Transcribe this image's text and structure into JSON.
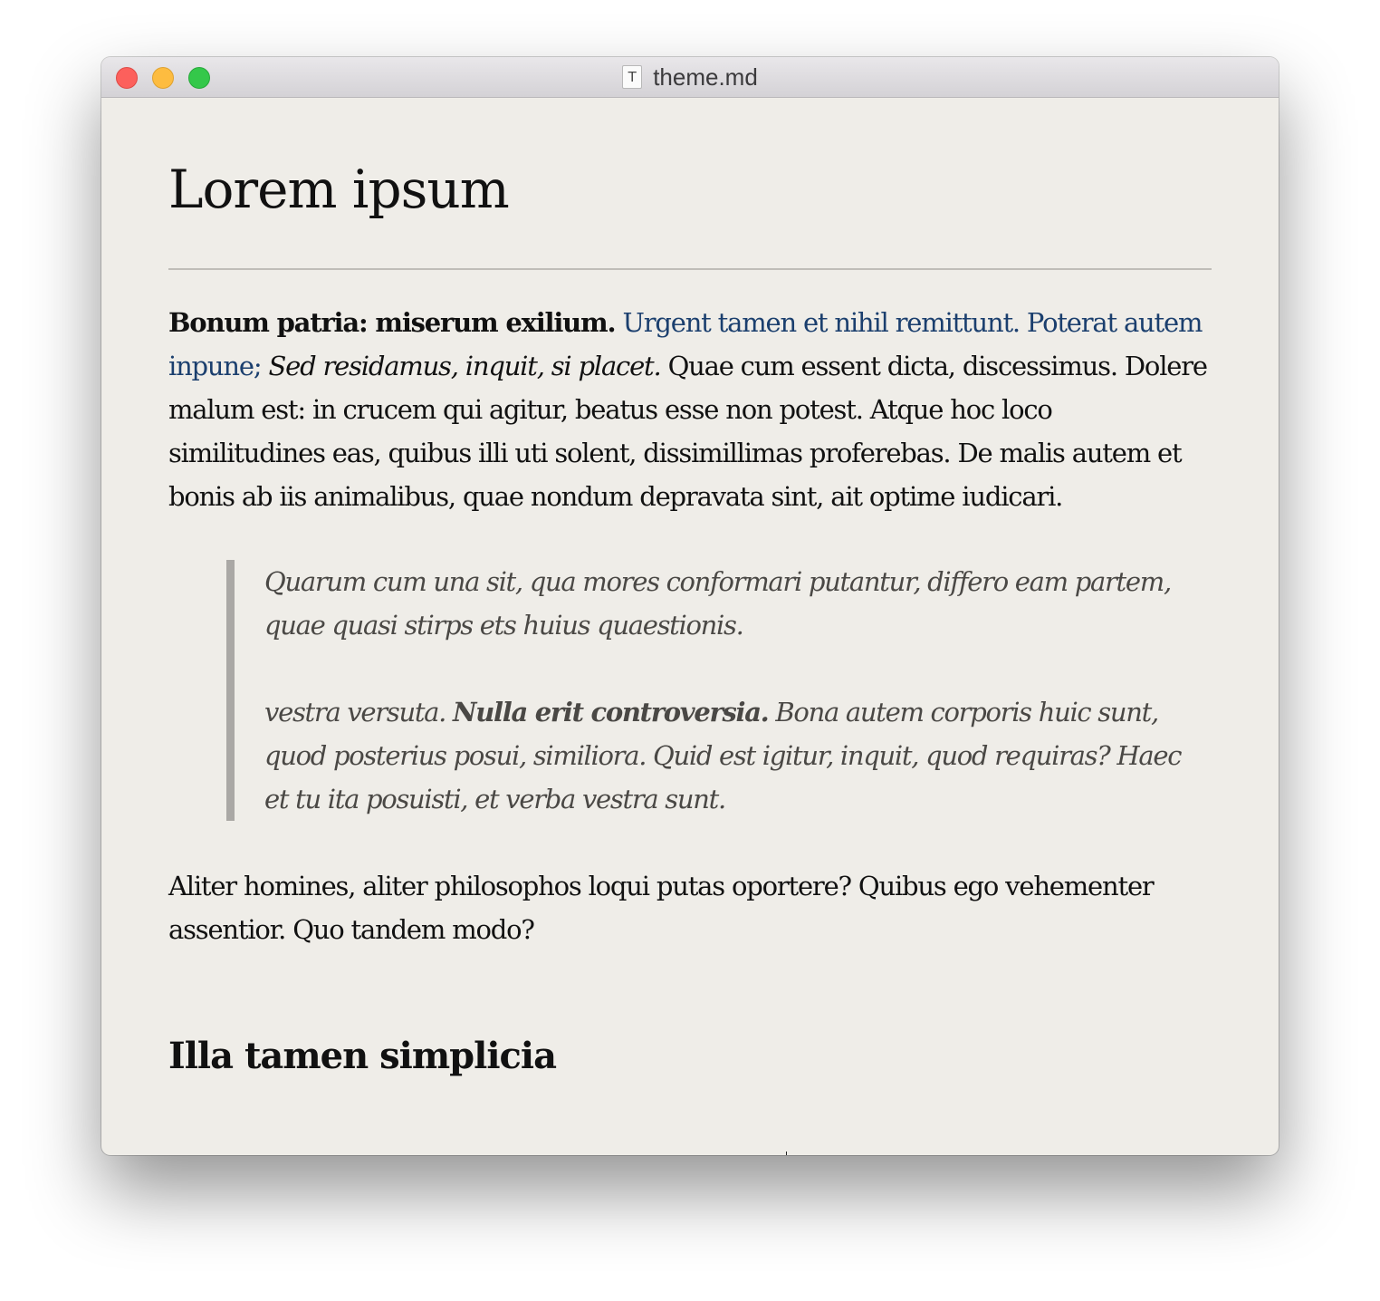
{
  "window": {
    "title": "theme.md",
    "file_type_glyph": "T",
    "icon": "document-icon"
  },
  "document": {
    "heading1": "Lorem ipsum",
    "para1": {
      "bold": "Bonum patria: miserum exilium.",
      "link": "Urgent tamen et nihil remittunt. Poterat autem inpune;",
      "italic": "Sed residamus, inquit, si placet.",
      "rest": "Quae cum essent dicta, discessimus. Dolere malum est: in crucem qui agitur, beatus esse non potest. Atque hoc loco similitudines eas, quibus illi uti solent, dissimillimas proferebas. De malis autem et bonis ab iis animalibus, quae nondum depravata sint, ait optime iudicari."
    },
    "blockquote": {
      "p1": "Quarum cum una sit, qua mores conformari putantur, differo eam partem, quae quasi stirps ets huius quaestionis.",
      "p2_start": "vestra versuta.",
      "p2_bold": "Nulla erit controversia.",
      "p2_rest": "Bona autem corporis huic sunt, quod posterius posui, similiora. Quid est igitur, inquit, quod requiras? Haec et tu ita posuisti, et verba vestra sunt."
    },
    "para2": "Aliter homines, aliter philosophos loqui putas oportere? Quibus ego vehementer assentior. Quo tandem modo?",
    "heading2": "Illa tamen simplicia"
  },
  "colors": {
    "background": "#efede8",
    "link": "#1b3f6e",
    "quote_text": "#4a4845",
    "quote_bar": "#aaa8a5",
    "close": "#fc605c",
    "minimize": "#fdbc40",
    "zoom": "#34c84a"
  }
}
